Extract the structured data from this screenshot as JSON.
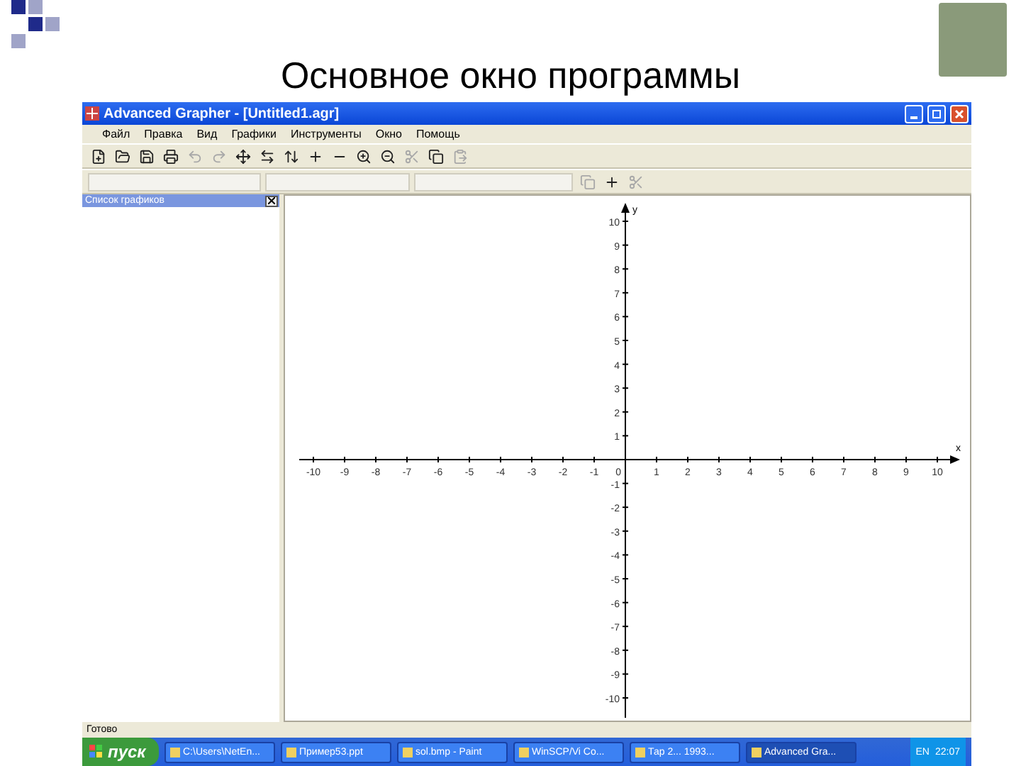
{
  "slide": {
    "title": "Основное окно программы"
  },
  "window": {
    "title": "Advanced Grapher - [Untitled1.agr]"
  },
  "menu": [
    "Файл",
    "Правка",
    "Вид",
    "Графики",
    "Инструменты",
    "Окно",
    "Помощь"
  ],
  "side_panel": {
    "title": "Список графиков"
  },
  "graph": {
    "x_label": "x",
    "y_label": "y",
    "x_ticks": [
      "-10",
      "-9",
      "-8",
      "-7",
      "-6",
      "-5",
      "-4",
      "-3",
      "-2",
      "-1",
      "0",
      "1",
      "2",
      "3",
      "4",
      "5",
      "6",
      "7",
      "8",
      "9",
      "10"
    ],
    "y_ticks": [
      "10",
      "9",
      "8",
      "7",
      "6",
      "5",
      "4",
      "3",
      "2",
      "1",
      "-1",
      "-2",
      "-3",
      "-4",
      "-5",
      "-6",
      "-7",
      "-8",
      "-9",
      "-10"
    ]
  },
  "status_bar": "Готово",
  "taskbar": {
    "start": "пуск",
    "tasks": [
      {
        "label": "C:\\Users\\NetEn...",
        "selected": false
      },
      {
        "label": "Пример53.ppt",
        "selected": false
      },
      {
        "label": "sol.bmp - Paint",
        "selected": false
      },
      {
        "label": "WinSCP/Vi Co...",
        "selected": false
      },
      {
        "label": "Тар 2... 1993...",
        "selected": false
      },
      {
        "label": "Advanced Gra...",
        "selected": true
      }
    ],
    "language": "EN",
    "clock": "22:07"
  }
}
